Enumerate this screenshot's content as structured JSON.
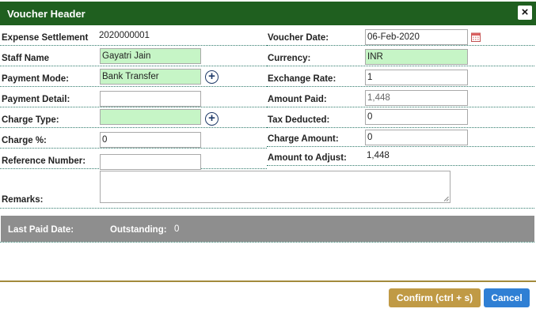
{
  "header": {
    "title": "Voucher Header",
    "close_label": "×"
  },
  "form": {
    "expense_settlement": {
      "label": "Expense Settlement",
      "value": "2020000001"
    },
    "staff_name": {
      "label": "Staff Name",
      "value": "Gayatri Jain"
    },
    "payment_mode": {
      "label": "Payment Mode:",
      "value": "Bank Transfer"
    },
    "payment_detail": {
      "label": "Payment Detail:",
      "value": ""
    },
    "charge_type": {
      "label": "Charge Type:",
      "value": ""
    },
    "charge_percent": {
      "label": "Charge %:",
      "value": "0"
    },
    "reference_number": {
      "label": "Reference Number:",
      "value": ""
    },
    "voucher_date": {
      "label": "Voucher Date:",
      "value": "06-Feb-2020"
    },
    "currency": {
      "label": "Currency:",
      "value": "INR"
    },
    "exchange_rate": {
      "label": "Exchange Rate:",
      "value": "1"
    },
    "amount_paid": {
      "label": "Amount Paid:",
      "value": "1,448"
    },
    "tax_deducted": {
      "label": "Tax Deducted:",
      "value": "0"
    },
    "charge_amount": {
      "label": "Charge Amount:",
      "value": "0"
    },
    "amount_to_adjust": {
      "label": "Amount to Adjust:",
      "value": "1,448"
    },
    "remarks": {
      "label": "Remarks:",
      "value": ""
    },
    "plus_glyph": "+"
  },
  "summary": {
    "last_paid_label": "Last Paid Date:",
    "outstanding_label": "Outstanding:",
    "outstanding_value": "0"
  },
  "footer": {
    "confirm_label": "Confirm (ctrl + s)",
    "cancel_label": "Cancel"
  },
  "colors": {
    "header_bg": "#1f5f1f",
    "field_required_bg": "#c6f5c6",
    "confirm_bg": "#c09a45",
    "cancel_bg": "#2f7fd4",
    "summary_bg": "#8e8e8e"
  },
  "icons": [
    "close-icon",
    "add-icon",
    "calendar-icon"
  ]
}
